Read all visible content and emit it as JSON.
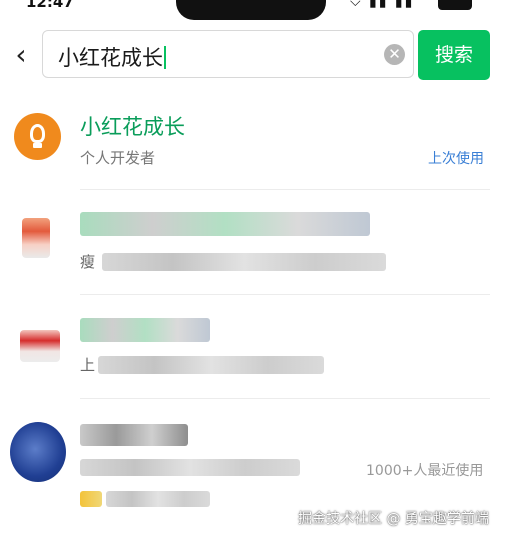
{
  "status_bar": {
    "time": "12:47"
  },
  "search": {
    "query": "小红花成长",
    "button_label": "搜索"
  },
  "results": [
    {
      "title": "小红花成长",
      "subtitle": "个人开发者",
      "tag": "上次使用",
      "tag_color": "#3a7fd5",
      "icon": "lightbulb-icon"
    },
    {
      "title": "小红花成长助手小程序",
      "subtitle": "瘦"
    },
    {
      "title": "小红花成长营",
      "subtitle": "上"
    },
    {
      "title": "",
      "subtitle": "",
      "tag": "1000+人最近使用",
      "tag_color": "#999999"
    }
  ],
  "watermark": "掘金技术社区 @ 勇宝趣学前端",
  "colors": {
    "accent": "#07c160",
    "title_green": "#0a9d5a",
    "bulb_orange": "#f08a1d"
  }
}
